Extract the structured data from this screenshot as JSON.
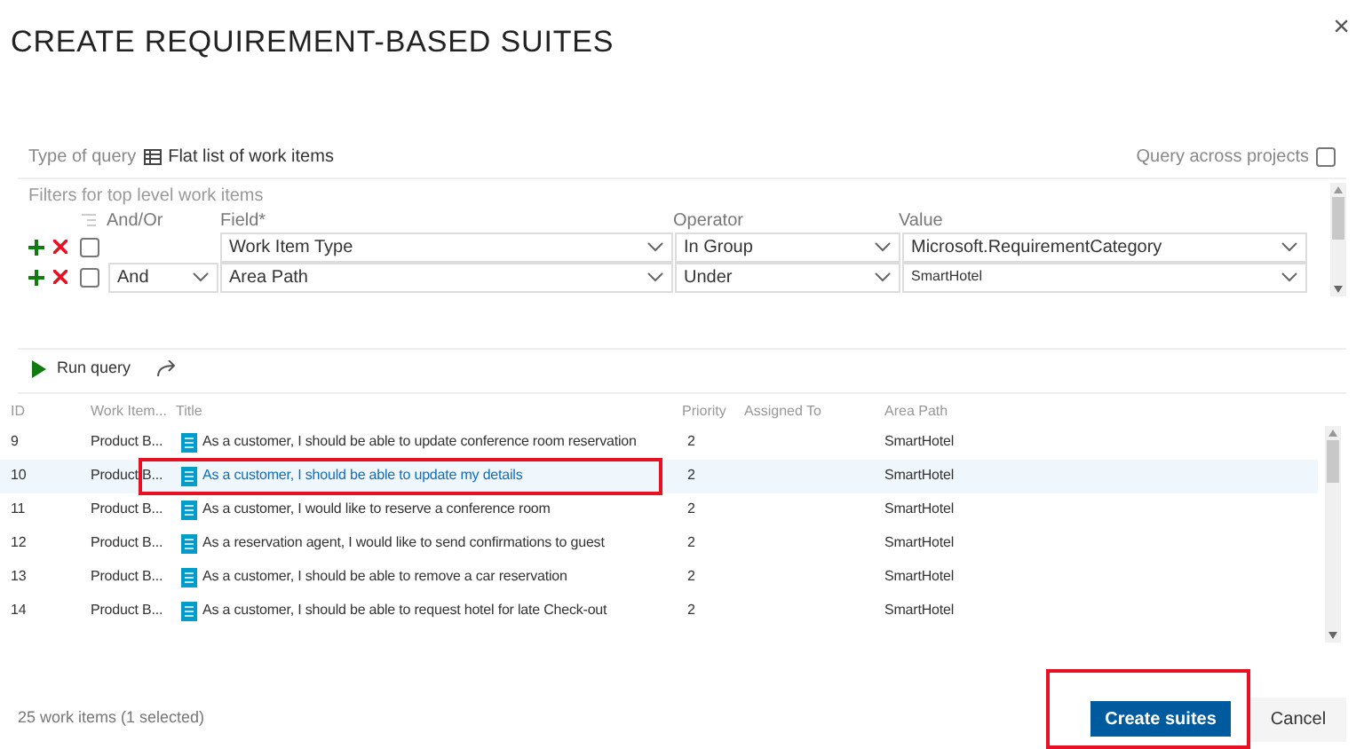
{
  "window": {
    "title": "CREATE REQUIREMENT-BASED SUITES",
    "close": "×"
  },
  "query": {
    "type_label": "Type of query",
    "type_value": "Flat list of work items",
    "across_label": "Query across projects",
    "across_checked": false
  },
  "filters": {
    "caption": "Filters for top level work items",
    "columns": [
      "And/Or",
      "Field*",
      "Operator",
      "Value"
    ],
    "rows": [
      {
        "checked": false,
        "and_or": "",
        "field": "Work Item Type",
        "operator": "In Group",
        "value": "Microsoft.RequirementCategory"
      },
      {
        "checked": false,
        "and_or": "And",
        "field": "Area Path",
        "operator": "Under",
        "value": "SmartHotel"
      }
    ]
  },
  "toolbar": {
    "run": "Run query"
  },
  "table": {
    "columns": [
      "ID",
      "Work Item...",
      "Title",
      "Priority",
      "Assigned To",
      "Area Path"
    ],
    "rows": [
      {
        "id": "9",
        "type": "Product B...",
        "title": "As a customer, I should be able to update conference room reservation",
        "priority": "2",
        "area": "SmartHotel",
        "selected": false
      },
      {
        "id": "10",
        "type": "Product B...",
        "title": "As a customer, I should be able to update my details",
        "priority": "2",
        "area": "SmartHotel",
        "selected": true
      },
      {
        "id": "11",
        "type": "Product B...",
        "title": "As a customer, I would like to reserve a conference room",
        "priority": "2",
        "area": "SmartHotel",
        "selected": false
      },
      {
        "id": "12",
        "type": "Product B...",
        "title": "As a reservation agent, I would like to send confirmations to guest",
        "priority": "2",
        "area": "SmartHotel",
        "selected": false
      },
      {
        "id": "13",
        "type": "Product B...",
        "title": "As a customer, I should be able to remove a car reservation",
        "priority": "2",
        "area": "SmartHotel",
        "selected": false
      },
      {
        "id": "14",
        "type": "Product B...",
        "title": "As a customer, I should be able to request hotel for late Check-out",
        "priority": "2",
        "area": "SmartHotel",
        "selected": false
      }
    ]
  },
  "status": "25 work items (1 selected)",
  "buttons": {
    "primary": "Create suites",
    "secondary": "Cancel"
  }
}
